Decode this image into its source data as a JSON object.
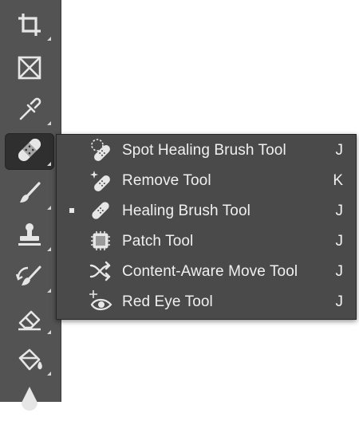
{
  "toolbar": {
    "tools": [
      {
        "name": "crop-tool",
        "icon": "crop-icon"
      },
      {
        "name": "frame-tool",
        "icon": "frame-icon"
      },
      {
        "name": "eyedropper-tool",
        "icon": "eyedropper-icon"
      },
      {
        "name": "healing-brush-tool",
        "icon": "bandage-icon",
        "active": true
      },
      {
        "name": "brush-tool",
        "icon": "brush-icon"
      },
      {
        "name": "clone-stamp-tool",
        "icon": "stamp-icon"
      },
      {
        "name": "history-brush-tool",
        "icon": "history-brush-icon"
      },
      {
        "name": "eraser-tool",
        "icon": "eraser-icon"
      },
      {
        "name": "paint-bucket-tool",
        "icon": "paint-bucket-icon"
      },
      {
        "name": "blur-tool",
        "icon": "blur-icon"
      }
    ]
  },
  "flyout": {
    "items": [
      {
        "label": "Spot Healing Brush Tool",
        "shortcut": "J",
        "icon": "spot-healing-icon",
        "selected": false
      },
      {
        "label": "Remove Tool",
        "shortcut": "K",
        "icon": "remove-tool-icon",
        "selected": false
      },
      {
        "label": "Healing Brush Tool",
        "shortcut": "J",
        "icon": "healing-brush-icon",
        "selected": true
      },
      {
        "label": "Patch Tool",
        "shortcut": "J",
        "icon": "patch-icon",
        "selected": false
      },
      {
        "label": "Content-Aware Move Tool",
        "shortcut": "J",
        "icon": "content-aware-move-icon",
        "selected": false
      },
      {
        "label": "Red Eye Tool",
        "shortcut": "J",
        "icon": "red-eye-icon",
        "selected": false
      }
    ]
  },
  "colors": {
    "toolbar_bg": "#535353",
    "flyout_bg": "#4a4a4a",
    "icon": "#e6e6e6",
    "canvas": "#ffffff"
  }
}
